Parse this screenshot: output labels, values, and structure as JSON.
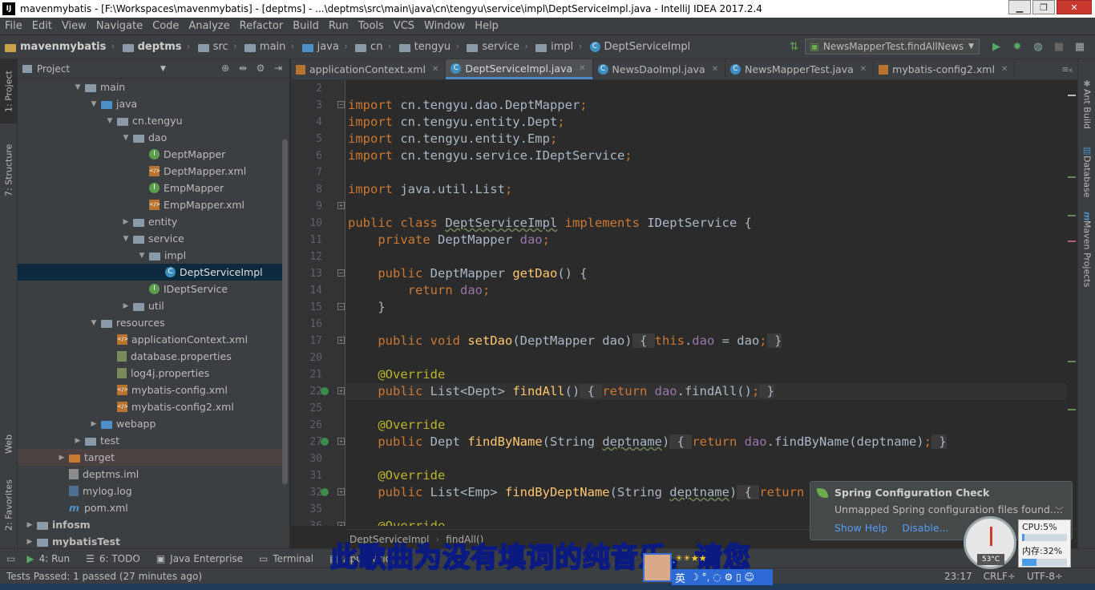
{
  "window": {
    "title": "mavenmybatis - [F:\\Workspaces\\mavenmybatis] - [deptms] - ...\\deptms\\src\\main\\java\\cn\\tengyu\\service\\impl\\DeptServiceImpl.java - IntelliJ IDEA 2017.2.4",
    "icon_label": "IJ"
  },
  "menu": [
    "File",
    "Edit",
    "View",
    "Navigate",
    "Code",
    "Analyze",
    "Refactor",
    "Build",
    "Run",
    "Tools",
    "VCS",
    "Window",
    "Help"
  ],
  "nav": {
    "crumbs": [
      "mavenmybatis",
      "deptms",
      "src",
      "main",
      "java",
      "cn",
      "tengyu",
      "service",
      "impl",
      "DeptServiceImpl"
    ],
    "run_config": "NewsMapperTest.findAllNews"
  },
  "left_tabs": {
    "project": "1: Project",
    "structure": "7: Structure",
    "web": "Web",
    "favorites": "2: Favorites"
  },
  "right_tabs": {
    "ant": "Ant Build",
    "database": "Database",
    "maven": "Maven Projects"
  },
  "project_panel": {
    "title": "Project",
    "tree": [
      {
        "label": "main",
        "indent": 4,
        "arrow": "▼",
        "icon": "folder"
      },
      {
        "label": "java",
        "indent": 5,
        "arrow": "▼",
        "icon": "folder-blue"
      },
      {
        "label": "cn.tengyu",
        "indent": 6,
        "arrow": "▼",
        "icon": "folder"
      },
      {
        "label": "dao",
        "indent": 7,
        "arrow": "▼",
        "icon": "folder"
      },
      {
        "label": "DeptMapper",
        "indent": 8,
        "arrow": "",
        "icon": "interface"
      },
      {
        "label": "DeptMapper.xml",
        "indent": 8,
        "arrow": "",
        "icon": "xml"
      },
      {
        "label": "EmpMapper",
        "indent": 8,
        "arrow": "",
        "icon": "interface"
      },
      {
        "label": "EmpMapper.xml",
        "indent": 8,
        "arrow": "",
        "icon": "xml"
      },
      {
        "label": "entity",
        "indent": 7,
        "arrow": "▶",
        "icon": "folder"
      },
      {
        "label": "service",
        "indent": 7,
        "arrow": "▼",
        "icon": "folder"
      },
      {
        "label": "impl",
        "indent": 8,
        "arrow": "▼",
        "icon": "folder"
      },
      {
        "label": "DeptServiceImpl",
        "indent": 9,
        "arrow": "",
        "icon": "class",
        "selected": true
      },
      {
        "label": "IDeptService",
        "indent": 8,
        "arrow": "",
        "icon": "interface"
      },
      {
        "label": "util",
        "indent": 7,
        "arrow": "▶",
        "icon": "folder"
      },
      {
        "label": "resources",
        "indent": 5,
        "arrow": "▼",
        "icon": "folder-res"
      },
      {
        "label": "applicationContext.xml",
        "indent": 6,
        "arrow": "",
        "icon": "xml"
      },
      {
        "label": "database.properties",
        "indent": 6,
        "arrow": "",
        "icon": "prop"
      },
      {
        "label": "log4j.properties",
        "indent": 6,
        "arrow": "",
        "icon": "prop"
      },
      {
        "label": "mybatis-config.xml",
        "indent": 6,
        "arrow": "",
        "icon": "xml"
      },
      {
        "label": "mybatis-config2.xml",
        "indent": 6,
        "arrow": "",
        "icon": "xml"
      },
      {
        "label": "webapp",
        "indent": 5,
        "arrow": "▶",
        "icon": "folder-blue"
      },
      {
        "label": "test",
        "indent": 4,
        "arrow": "▶",
        "icon": "folder"
      },
      {
        "label": "target",
        "indent": 3,
        "arrow": "▶",
        "icon": "folder-orange",
        "highlight": true
      },
      {
        "label": "deptms.iml",
        "indent": 3,
        "arrow": "",
        "icon": "file"
      },
      {
        "label": "mylog.log",
        "indent": 3,
        "arrow": "",
        "icon": "log"
      },
      {
        "label": "pom.xml",
        "indent": 3,
        "arrow": "",
        "icon": "maven"
      },
      {
        "label": "infosm",
        "indent": 1,
        "arrow": "▶",
        "icon": "folder",
        "bold": true
      },
      {
        "label": "mybatisTest",
        "indent": 1,
        "arrow": "▶",
        "icon": "folder",
        "bold": true
      }
    ]
  },
  "editor": {
    "tabs": [
      {
        "label": "applicationContext.xml",
        "icon": "xml",
        "active": false
      },
      {
        "label": "DeptServiceImpl.java",
        "icon": "class",
        "active": true
      },
      {
        "label": "NewsDaoImpl.java",
        "icon": "class",
        "active": false
      },
      {
        "label": "NewsMapperTest.java",
        "icon": "class",
        "active": false
      },
      {
        "label": "mybatis-config2.xml",
        "icon": "xml",
        "active": false
      }
    ],
    "line_numbers": [
      "2",
      "3",
      "4",
      "5",
      "6",
      "7",
      "8",
      "9",
      "10",
      "11",
      "12",
      "13",
      "14",
      "15",
      "16",
      "17",
      "20",
      "21",
      "22",
      "25",
      "26",
      "27",
      "30",
      "31",
      "32",
      "35",
      "36"
    ],
    "breadcrumb": [
      "DeptServiceImpl",
      "findAll()"
    ]
  },
  "tool_windows": [
    {
      "label": "4: Run",
      "icon": "▶"
    },
    {
      "label": "6: TODO",
      "icon": "☰"
    },
    {
      "label": "Java Enterprise",
      "icon": "▣"
    },
    {
      "label": "Terminal",
      "icon": "▭"
    },
    {
      "label": "Applicatio",
      "icon": "▤"
    }
  ],
  "status": {
    "message": "Tests Passed: 1 passed (27 minutes ago)",
    "position": "23:17",
    "line_sep": "CRLF÷",
    "encoding": "UTF-8÷"
  },
  "notification": {
    "title": "Spring Configuration Check",
    "message": "Unmapped Spring configuration files found....",
    "link_help": "Show Help",
    "link_disable": "Disable..."
  },
  "overlay": {
    "subtitle": "此歌曲为没有填词的纯音乐，请您",
    "ime_label": "英",
    "ime_tools": "☽ °, ◌ ⚙ ▯ ☺",
    "cpu_label": "CPU:5%",
    "cpu_percent": 5,
    "mem_label": "内存:32%",
    "mem_percent": 32,
    "temp": "53°C"
  }
}
